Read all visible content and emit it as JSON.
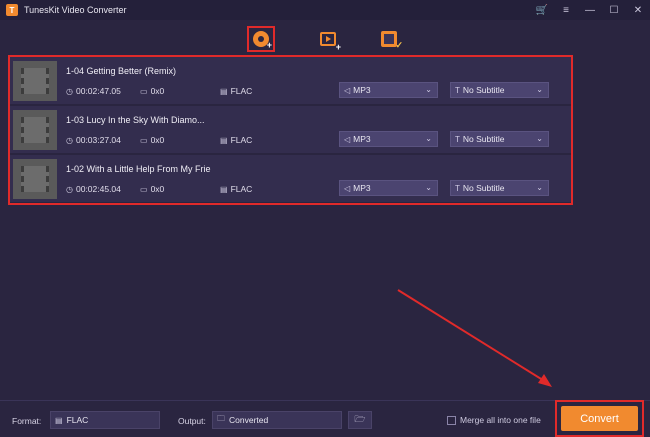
{
  "app": {
    "title": "TunesKit Video Converter",
    "colors": {
      "accent": "#f18a2f",
      "highlight": "#e02a2a",
      "background": "#2a2540"
    }
  },
  "window_controls": {
    "cart_icon": "cart-icon",
    "menu_icon": "menu-icon",
    "minimize": "—",
    "maximize": "☐",
    "close": "✕"
  },
  "toolbar": {
    "add_file_icon": "add-file-icon",
    "add_video_icon": "add-video-icon",
    "task_icon": "task-icon"
  },
  "files": [
    {
      "name": "1-04 Getting Better (Remix)",
      "duration": "00:02:47.05",
      "resolution": "0x0",
      "format": "FLAC",
      "output_format": "MP3",
      "subtitle": "No Subtitle"
    },
    {
      "name": "1-03 Lucy In the Sky With Diamo...",
      "duration": "00:03:27.04",
      "resolution": "0x0",
      "format": "FLAC",
      "output_format": "MP3",
      "subtitle": "No Subtitle"
    },
    {
      "name": "1-02 With a Little Help From My Frie",
      "duration": "00:02:45.04",
      "resolution": "0x0",
      "format": "FLAC",
      "output_format": "MP3",
      "subtitle": "No Subtitle"
    }
  ],
  "bottom": {
    "format_label": "Format:",
    "format_value": "FLAC",
    "output_label": "Output:",
    "output_value": "Converted",
    "merge_label": "Merge all into one file",
    "convert_label": "Convert"
  }
}
